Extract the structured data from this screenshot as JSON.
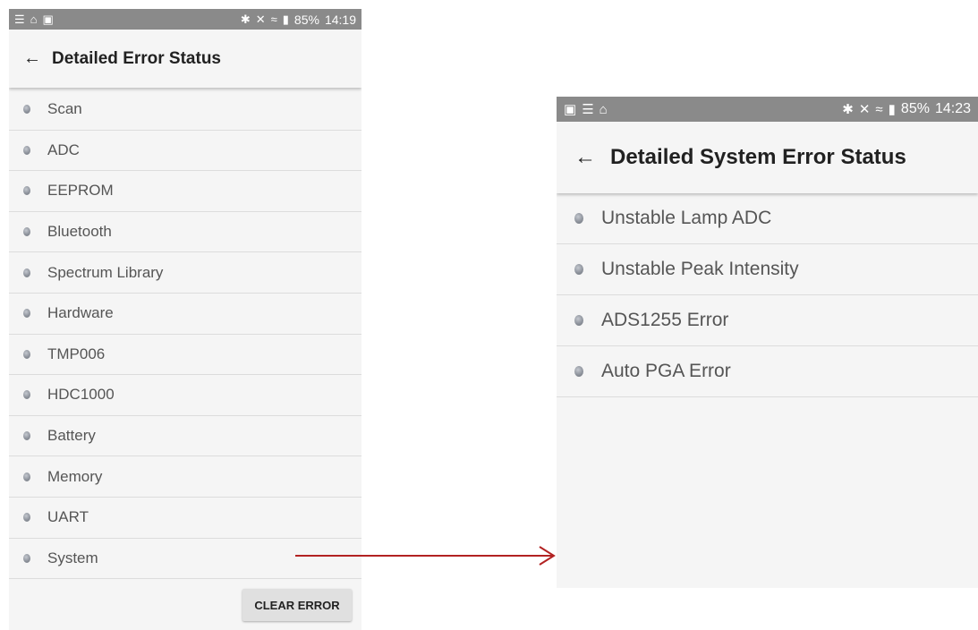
{
  "left_screen": {
    "status_bar": {
      "left_icons": [
        "☰",
        "⌂",
        "▣"
      ],
      "right_icons": [
        "✱",
        "✕",
        "≈",
        "▮"
      ],
      "battery": "85%",
      "time": "14:19"
    },
    "back_icon": "←",
    "title": "Detailed Error Status",
    "items": [
      {
        "label": "Scan"
      },
      {
        "label": "ADC"
      },
      {
        "label": "EEPROM"
      },
      {
        "label": "Bluetooth"
      },
      {
        "label": "Spectrum Library"
      },
      {
        "label": "Hardware"
      },
      {
        "label": "TMP006"
      },
      {
        "label": "HDC1000"
      },
      {
        "label": "Battery"
      },
      {
        "label": "Memory"
      },
      {
        "label": "UART"
      },
      {
        "label": "System"
      }
    ],
    "clear_button": "CLEAR ERROR"
  },
  "right_screen": {
    "status_bar": {
      "left_icons": [
        "▣",
        "☰",
        "⌂"
      ],
      "right_icons": [
        "✱",
        "✕",
        "≈",
        "▮"
      ],
      "battery": "85%",
      "time": "14:23"
    },
    "back_icon": "←",
    "title": "Detailed System Error Status",
    "items": [
      {
        "label": "Unstable Lamp ADC"
      },
      {
        "label": "Unstable Peak Intensity"
      },
      {
        "label": "ADS1255 Error"
      },
      {
        "label": "Auto PGA Error"
      }
    ]
  },
  "colors": {
    "status_bar": "#8a8a8a",
    "background": "#f5f5f5",
    "arrow": "#b22222"
  }
}
